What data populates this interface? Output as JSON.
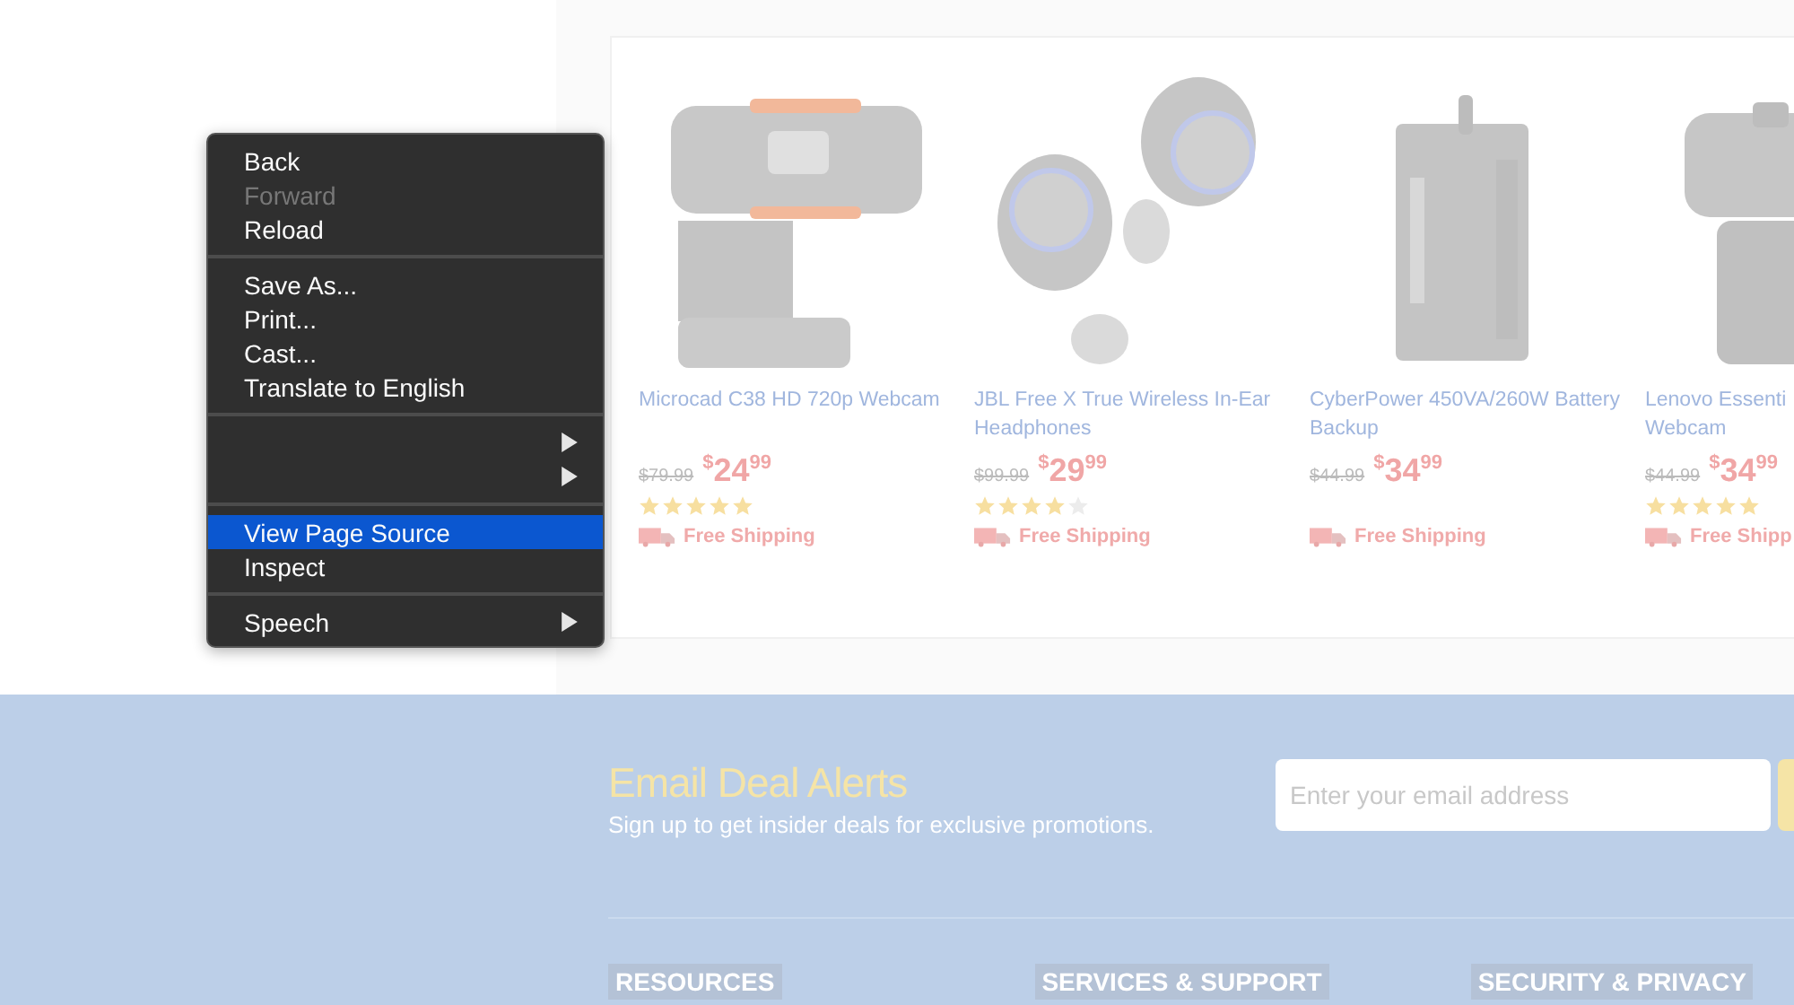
{
  "products": [
    {
      "title": "Microcad C38 HD 720p Webcam",
      "old_price": "$79.99",
      "price": {
        "currency": "$",
        "dollars": "24",
        "cents": "99"
      },
      "stars": 5,
      "shipping": "Free Shipping",
      "kind": "picture"
    },
    {
      "title": "JBL Free X True Wireless In-Ear Headphones",
      "old_price": "$99.99",
      "price": {
        "currency": "$",
        "dollars": "29",
        "cents": "99"
      },
      "stars": 4,
      "shipping": "Free Shipping",
      "kind": "picture"
    },
    {
      "title": "CyberPower 450VA/260W Battery Backup",
      "old_price": "$44.99",
      "price": {
        "currency": "$",
        "dollars": "34",
        "cents": "99"
      },
      "shipping": "Free Shipping",
      "kind": "picture"
    },
    {
      "title": "Lenovo Essenti",
      "title_2": "Webcam",
      "old_price": "$44.99",
      "price": {
        "currency": "$",
        "dollars": "34",
        "cents": "99"
      },
      "stars": 5,
      "shipping": "Free Shipp",
      "kind": "picture"
    }
  ],
  "newsletter": {
    "title": "Email Deal Alerts",
    "subtitle": "Sign up to get insider deals for exclusive promotions.",
    "email": {
      "placeholder": "Enter your email address"
    }
  },
  "footer": {
    "headings": [
      "RESOURCES",
      "SERVICES & SUPPORT",
      "SECURITY & PRIVACY"
    ]
  },
  "context_menu": {
    "items": [
      {
        "kind": "item",
        "label": "Back",
        "disabled": false,
        "selected": false,
        "submenu": false
      },
      {
        "kind": "item",
        "label": "Forward",
        "disabled": true,
        "selected": false,
        "submenu": false
      },
      {
        "kind": "item",
        "label": "Reload",
        "disabled": false,
        "selected": false,
        "submenu": false
      },
      {
        "kind": "separator"
      },
      {
        "kind": "item",
        "label": "Save As...",
        "disabled": false,
        "selected": false,
        "submenu": false
      },
      {
        "kind": "item",
        "label": "Print...",
        "disabled": false,
        "selected": false,
        "submenu": false
      },
      {
        "kind": "item",
        "label": "Cast...",
        "disabled": false,
        "selected": false,
        "submenu": false
      },
      {
        "kind": "item",
        "label": "Translate to English",
        "disabled": false,
        "selected": false,
        "submenu": false
      },
      {
        "kind": "separator"
      },
      {
        "kind": "item",
        "disabled": false,
        "selected": false,
        "submenu": true
      },
      {
        "kind": "item",
        "disabled": false,
        "selected": false,
        "submenu": true
      },
      {
        "kind": "separator"
      },
      {
        "kind": "item",
        "label": "View Page Source",
        "disabled": false,
        "selected": true,
        "submenu": false
      },
      {
        "kind": "item",
        "label": "Inspect",
        "disabled": false,
        "selected": false,
        "submenu": false
      },
      {
        "kind": "separator"
      },
      {
        "kind": "item",
        "label": "Speech",
        "disabled": false,
        "selected": false,
        "submenu": true
      }
    ]
  }
}
